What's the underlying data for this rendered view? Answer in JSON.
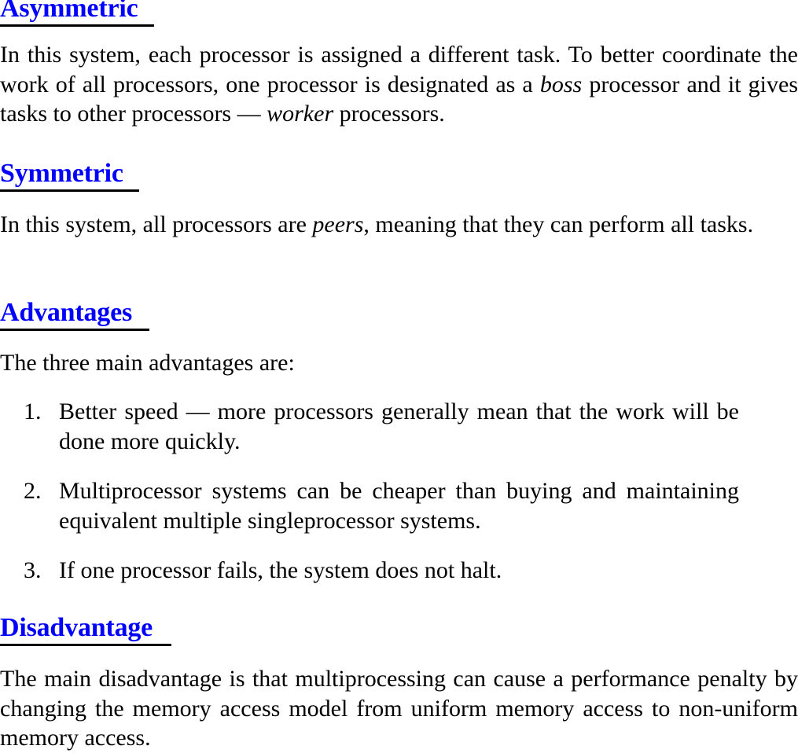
{
  "document": {
    "sections": [
      {
        "id": "asymmetric",
        "heading": "Asymmetric",
        "paragraph_parts": {
          "p1": "In this system, each processor is assigned a different task. To better coordinate the work of all processors, one processor is designated as a ",
          "em1": "boss",
          "p2": " processor and it gives tasks to other processors — ",
          "em2": "worker",
          "p3": " processors."
        }
      },
      {
        "id": "symmetric",
        "heading": "Symmetric",
        "paragraph_parts": {
          "p1": "In this system, all processors are ",
          "em1": "peers",
          "p2": ", meaning that they can perform all tasks."
        }
      },
      {
        "id": "advantages",
        "heading": "Advantages",
        "intro": "The three main advantages are:",
        "items": [
          {
            "marker": "1.",
            "text": "Better speed — more processors generally mean that the work will be done more quickly."
          },
          {
            "marker": "2.",
            "text": "Multiprocessor systems can be cheaper than buying and maintaining equivalent multiple singleprocessor systems."
          },
          {
            "marker": "3.",
            "text": "If one processor fails, the system does not halt."
          }
        ]
      },
      {
        "id": "disadvantage",
        "heading": "Disadvantage",
        "paragraph": "The main disadvantage is that multiprocessing can cause a performance penalty by changing the memory access model from uniform memory access to non-uniform memory access."
      }
    ]
  },
  "colors": {
    "heading": "#0000ff",
    "text": "#000000",
    "rule": "#000000",
    "background": "#ffffff"
  }
}
